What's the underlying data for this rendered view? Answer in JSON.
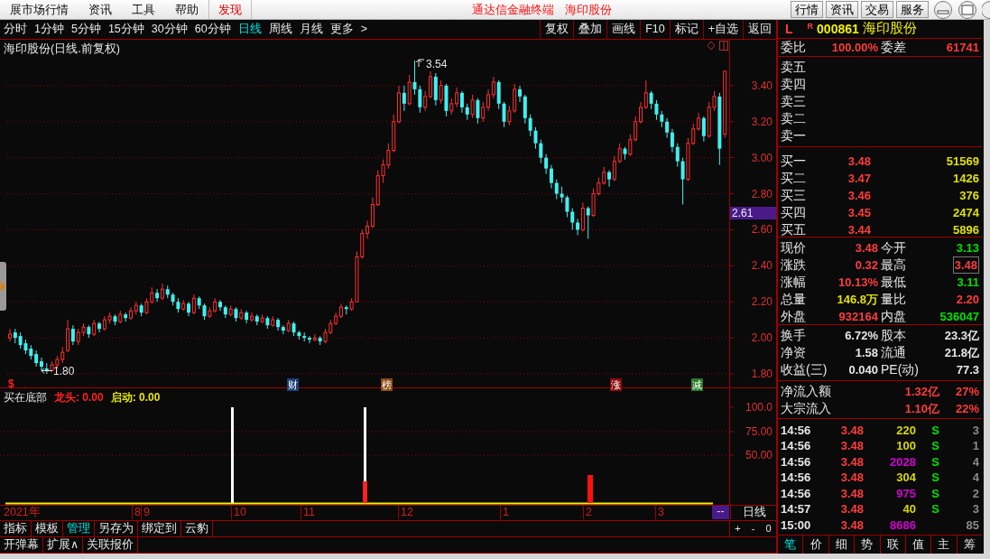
{
  "menu": [
    {
      "label": "展市场行情",
      "highlighted": false
    },
    {
      "label": "资讯",
      "highlighted": false
    },
    {
      "label": "工具",
      "highlighted": false
    },
    {
      "label": "帮助",
      "highlighted": false
    },
    {
      "label": "发现",
      "highlighted": true
    }
  ],
  "title_bar": {
    "app": "通达信金融终端",
    "stock": "海印股份"
  },
  "top_buttons": [
    "行情",
    "资讯",
    "交易",
    "服务"
  ],
  "periods": [
    {
      "label": "分时",
      "selected": false
    },
    {
      "label": "1分钟",
      "selected": false
    },
    {
      "label": "5分钟",
      "selected": false
    },
    {
      "label": "15分钟",
      "selected": false
    },
    {
      "label": "30分钟",
      "selected": false
    },
    {
      "label": "60分钟",
      "selected": false
    },
    {
      "label": "日线",
      "selected": true
    },
    {
      "label": "周线",
      "selected": false
    },
    {
      "label": "月线",
      "selected": false
    },
    {
      "label": "更多",
      "selected": false
    },
    {
      "label": ">",
      "selected": false
    }
  ],
  "chart_buttons": [
    "复权",
    "叠加",
    "画线",
    "F10",
    "标记",
    "+自选",
    "返回"
  ],
  "chart": {
    "title": "海印股份(日线.前复权)",
    "high_label": "3.54",
    "low_label": "1.80",
    "cursor_price": "2.61",
    "marker": "$",
    "badges": [
      {
        "label": "财",
        "color": "#1c3f78"
      },
      {
        "label": "榜",
        "color": "#8a4a12"
      },
      {
        "label": "涨",
        "color": "#8b0a0a"
      },
      {
        "label": "减",
        "color": "#2a7a2a"
      }
    ],
    "chart_data": {
      "type": "candlestick",
      "ylim": [
        1.79,
        3.655
      ],
      "grid": true,
      "yticks": [
        {
          "value": 3.4,
          "label": "3.40"
        },
        {
          "value": 3.2,
          "label": "3.20"
        },
        {
          "value": 3.0,
          "label": "3.00"
        },
        {
          "value": 2.8,
          "label": "2.80"
        },
        {
          "value": 2.6,
          "label": "2.60"
        },
        {
          "value": 2.4,
          "label": "2.40"
        },
        {
          "value": 2.2,
          "label": "2.20"
        },
        {
          "value": 2.0,
          "label": "2.00"
        },
        {
          "value": 1.8,
          "label": "1.80"
        }
      ],
      "ohlc": [
        [
          2.0,
          2.05,
          1.98,
          2.02
        ],
        [
          2.03,
          2.05,
          1.97,
          2.0
        ],
        [
          2.01,
          2.03,
          1.94,
          1.96
        ],
        [
          1.97,
          1.99,
          1.91,
          1.93
        ],
        [
          1.94,
          1.96,
          1.88,
          1.9
        ],
        [
          1.91,
          1.93,
          1.84,
          1.86
        ],
        [
          1.87,
          1.89,
          1.82,
          1.84
        ],
        [
          1.83,
          1.86,
          1.8,
          1.82
        ],
        [
          1.82,
          1.87,
          1.81,
          1.85
        ],
        [
          1.85,
          1.9,
          1.83,
          1.88
        ],
        [
          1.88,
          1.95,
          1.86,
          1.92
        ],
        [
          1.93,
          2.1,
          1.92,
          2.05
        ],
        [
          2.05,
          2.07,
          1.96,
          1.98
        ],
        [
          1.98,
          2.05,
          1.96,
          2.03
        ],
        [
          2.03,
          2.08,
          2.01,
          2.06
        ],
        [
          2.06,
          2.07,
          2.0,
          2.02
        ],
        [
          2.02,
          2.1,
          2.01,
          2.08
        ],
        [
          2.08,
          2.09,
          2.03,
          2.05
        ],
        [
          2.05,
          2.12,
          2.04,
          2.1
        ],
        [
          2.1,
          2.14,
          2.08,
          2.12
        ],
        [
          2.12,
          2.13,
          2.07,
          2.09
        ],
        [
          2.09,
          2.15,
          2.08,
          2.13
        ],
        [
          2.13,
          2.14,
          2.09,
          2.11
        ],
        [
          2.11,
          2.17,
          2.1,
          2.15
        ],
        [
          2.15,
          2.2,
          2.13,
          2.18
        ],
        [
          2.18,
          2.19,
          2.12,
          2.14
        ],
        [
          2.14,
          2.22,
          2.13,
          2.2
        ],
        [
          2.2,
          2.28,
          2.19,
          2.25
        ],
        [
          2.25,
          2.27,
          2.2,
          2.22
        ],
        [
          2.22,
          2.3,
          2.21,
          2.27
        ],
        [
          2.27,
          2.29,
          2.22,
          2.24
        ],
        [
          2.24,
          2.25,
          2.18,
          2.2
        ],
        [
          2.2,
          2.22,
          2.14,
          2.16
        ],
        [
          2.16,
          2.21,
          2.15,
          2.19
        ],
        [
          2.19,
          2.2,
          2.12,
          2.14
        ],
        [
          2.14,
          2.24,
          2.13,
          2.22
        ],
        [
          2.22,
          2.23,
          2.16,
          2.18
        ],
        [
          2.18,
          2.19,
          2.1,
          2.12
        ],
        [
          2.12,
          2.17,
          2.11,
          2.15
        ],
        [
          2.15,
          2.22,
          2.14,
          2.2
        ],
        [
          2.2,
          2.21,
          2.15,
          2.17
        ],
        [
          2.17,
          2.18,
          2.11,
          2.13
        ],
        [
          2.13,
          2.18,
          2.12,
          2.16
        ],
        [
          2.16,
          2.17,
          2.09,
          2.11
        ],
        [
          2.11,
          2.16,
          2.1,
          2.14
        ],
        [
          2.14,
          2.15,
          2.08,
          2.1
        ],
        [
          2.1,
          2.14,
          2.09,
          2.12
        ],
        [
          2.12,
          2.13,
          2.07,
          2.09
        ],
        [
          2.09,
          2.13,
          2.08,
          2.11
        ],
        [
          2.11,
          2.12,
          2.05,
          2.07
        ],
        [
          2.07,
          2.12,
          2.06,
          2.1
        ],
        [
          2.1,
          2.11,
          2.04,
          2.06
        ],
        [
          2.06,
          2.07,
          2.02,
          2.04
        ],
        [
          2.04,
          2.1,
          2.03,
          2.08
        ],
        [
          2.08,
          2.09,
          2.01,
          2.03
        ],
        [
          2.03,
          2.04,
          1.99,
          2.01
        ],
        [
          2.01,
          2.03,
          1.98,
          2.0
        ],
        [
          2.0,
          2.01,
          1.97,
          1.99
        ],
        [
          1.99,
          2.02,
          1.98,
          2.0
        ],
        [
          2.0,
          2.01,
          1.96,
          1.98
        ],
        [
          1.98,
          2.05,
          1.97,
          2.03
        ],
        [
          2.03,
          2.1,
          2.02,
          2.08
        ],
        [
          2.08,
          2.14,
          2.07,
          2.12
        ],
        [
          2.12,
          2.19,
          2.11,
          2.17
        ],
        [
          2.17,
          2.18,
          2.13,
          2.16
        ],
        [
          2.16,
          2.22,
          2.15,
          2.2
        ],
        [
          2.2,
          2.48,
          2.2,
          2.45
        ],
        [
          2.45,
          2.6,
          2.44,
          2.58
        ],
        [
          2.58,
          2.65,
          2.55,
          2.62
        ],
        [
          2.62,
          2.78,
          2.61,
          2.74
        ],
        [
          2.74,
          2.93,
          2.73,
          2.9
        ],
        [
          2.9,
          2.99,
          2.86,
          2.96
        ],
        [
          2.96,
          3.08,
          2.94,
          3.04
        ],
        [
          3.04,
          3.24,
          3.03,
          3.2
        ],
        [
          3.2,
          3.4,
          3.19,
          3.36
        ],
        [
          3.36,
          3.4,
          3.26,
          3.3
        ],
        [
          3.3,
          3.46,
          3.29,
          3.42
        ],
        [
          3.42,
          3.54,
          3.35,
          3.38
        ],
        [
          3.38,
          3.4,
          3.25,
          3.28
        ],
        [
          3.28,
          3.37,
          3.26,
          3.34
        ],
        [
          3.34,
          3.48,
          3.33,
          3.45
        ],
        [
          3.45,
          3.47,
          3.29,
          3.32
        ],
        [
          3.32,
          3.43,
          3.3,
          3.4
        ],
        [
          3.4,
          3.41,
          3.23,
          3.26
        ],
        [
          3.26,
          3.33,
          3.24,
          3.3
        ],
        [
          3.3,
          3.39,
          3.28,
          3.36
        ],
        [
          3.36,
          3.37,
          3.25,
          3.28
        ],
        [
          3.28,
          3.3,
          3.21,
          3.24
        ],
        [
          3.24,
          3.35,
          3.22,
          3.32
        ],
        [
          3.32,
          3.33,
          3.19,
          3.22
        ],
        [
          3.22,
          3.31,
          3.2,
          3.28
        ],
        [
          3.28,
          3.38,
          3.26,
          3.35
        ],
        [
          3.35,
          3.45,
          3.33,
          3.42
        ],
        [
          3.42,
          3.43,
          3.27,
          3.3
        ],
        [
          3.3,
          3.31,
          3.17,
          3.2
        ],
        [
          3.2,
          3.29,
          3.18,
          3.26
        ],
        [
          3.26,
          3.41,
          3.25,
          3.38
        ],
        [
          3.38,
          3.4,
          3.31,
          3.34
        ],
        [
          3.34,
          3.35,
          3.19,
          3.22
        ],
        [
          3.22,
          3.24,
          3.12,
          3.15
        ],
        [
          3.15,
          3.17,
          3.05,
          3.08
        ],
        [
          3.08,
          3.1,
          2.97,
          3.0
        ],
        [
          3.0,
          3.02,
          2.91,
          2.94
        ],
        [
          2.94,
          2.96,
          2.83,
          2.86
        ],
        [
          2.86,
          2.88,
          2.77,
          2.8
        ],
        [
          2.8,
          2.84,
          2.75,
          2.78
        ],
        [
          2.78,
          2.79,
          2.67,
          2.7
        ],
        [
          2.7,
          2.72,
          2.6,
          2.64
        ],
        [
          2.64,
          2.66,
          2.57,
          2.6
        ],
        [
          2.6,
          2.75,
          2.59,
          2.72
        ],
        [
          2.72,
          2.73,
          2.55,
          2.68
        ],
        [
          2.68,
          2.83,
          2.67,
          2.8
        ],
        [
          2.8,
          2.89,
          2.79,
          2.86
        ],
        [
          2.86,
          2.95,
          2.85,
          2.92
        ],
        [
          2.92,
          2.93,
          2.84,
          2.88
        ],
        [
          2.88,
          3.01,
          2.87,
          2.98
        ],
        [
          2.98,
          3.08,
          2.97,
          3.05
        ],
        [
          3.05,
          3.06,
          2.99,
          3.02
        ],
        [
          3.02,
          3.13,
          3.01,
          3.1
        ],
        [
          3.1,
          3.23,
          3.09,
          3.2
        ],
        [
          3.2,
          3.31,
          3.19,
          3.28
        ],
        [
          3.28,
          3.43,
          3.27,
          3.36
        ],
        [
          3.36,
          3.37,
          3.27,
          3.3
        ],
        [
          3.3,
          3.32,
          3.21,
          3.24
        ],
        [
          3.24,
          3.26,
          3.17,
          3.2
        ],
        [
          3.2,
          3.22,
          3.11,
          3.14
        ],
        [
          3.14,
          3.16,
          3.03,
          3.06
        ],
        [
          3.06,
          3.08,
          2.95,
          2.98
        ],
        [
          2.98,
          3.0,
          2.74,
          2.88
        ],
        [
          2.88,
          3.11,
          2.87,
          3.08
        ],
        [
          3.08,
          3.19,
          3.07,
          3.16
        ],
        [
          3.16,
          3.25,
          3.15,
          3.22
        ],
        [
          3.22,
          3.23,
          3.09,
          3.12
        ],
        [
          3.12,
          3.31,
          3.11,
          3.28
        ],
        [
          3.28,
          3.37,
          3.26,
          3.34
        ],
        [
          3.34,
          3.36,
          2.96,
          3.05
        ],
        [
          3.13,
          3.48,
          3.11,
          3.48
        ]
      ]
    }
  },
  "indicator": {
    "name": "买在底部",
    "lines": [
      {
        "label": "龙头: 0.00",
        "color": "#ff2020"
      },
      {
        "label": "启动: 0.00",
        "color": "#e6e600"
      }
    ],
    "axis": [
      "100.0",
      "75.00",
      "50.00"
    ]
  },
  "date_axis": [
    "2021年",
    "8",
    "9",
    "10",
    "11",
    "12",
    "1",
    "2",
    "3"
  ],
  "date_cursor": "--",
  "period_label": "日线",
  "indicator_tabs": [
    {
      "label": "指标",
      "selected": false
    },
    {
      "label": "模板",
      "selected": false
    },
    {
      "label": "管理",
      "selected": true
    },
    {
      "label": "另存为",
      "selected": false
    },
    {
      "label": "绑定到",
      "selected": false
    },
    {
      "label": "云豹",
      "selected": false
    }
  ],
  "zoom_buttons": [
    "+",
    "-",
    "0"
  ],
  "bottom_buttons": [
    "开弹幕",
    "扩展∧",
    "关联报价"
  ],
  "quote": {
    "market": "L",
    "flag": "R",
    "code": "000861",
    "name": "海印股份",
    "ratio": [
      {
        "label": "委比",
        "value": "100.00%",
        "color": "#ff3c3c"
      },
      {
        "label": "委差",
        "value": "61741",
        "color": "#ff3c3c"
      }
    ],
    "asks": [
      "卖五",
      "卖四",
      "卖三",
      "卖二",
      "卖一"
    ],
    "bids": [
      {
        "label": "买一",
        "price": "3.48",
        "volume": "51569"
      },
      {
        "label": "买二",
        "price": "3.47",
        "volume": "1426"
      },
      {
        "label": "买三",
        "price": "3.46",
        "volume": "376"
      },
      {
        "label": "买四",
        "price": "3.45",
        "volume": "2474"
      },
      {
        "label": "买五",
        "price": "3.44",
        "volume": "5896"
      }
    ],
    "stats": [
      {
        "label": "现价",
        "value": "3.48",
        "color": "#ff3c3c",
        "boxed": false
      },
      {
        "label": "今开",
        "value": "3.13",
        "color": "#00e000",
        "boxed": false
      },
      {
        "label": "涨跌",
        "value": "0.32",
        "color": "#ff3c3c",
        "boxed": false
      },
      {
        "label": "最高",
        "value": "3.48",
        "color": "#ff3c3c",
        "boxed": true
      },
      {
        "label": "涨幅",
        "value": "10.13%",
        "color": "#ff3c3c",
        "boxed": false
      },
      {
        "label": "最低",
        "value": "3.11",
        "color": "#00e000",
        "boxed": false
      },
      {
        "label": "总量",
        "value": "146.8万",
        "color": "#e0e000",
        "boxed": false
      },
      {
        "label": "量比",
        "value": "2.20",
        "color": "#ff3c3c",
        "boxed": false
      },
      {
        "label": "外盘",
        "value": "932164",
        "color": "#ff3c3c",
        "boxed": false
      },
      {
        "label": "内盘",
        "value": "536047",
        "color": "#00e000",
        "boxed": false
      }
    ],
    "finance": [
      {
        "label": "换手",
        "value": "6.72%"
      },
      {
        "label": "股本",
        "value": "23.3亿"
      },
      {
        "label": "净资",
        "value": "1.58"
      },
      {
        "label": "流通",
        "value": "21.8亿"
      },
      {
        "label": "收益(三)",
        "value": "0.040"
      },
      {
        "label": "PE(动)",
        "value": "77.3"
      }
    ],
    "flows": [
      {
        "label": "净流入额",
        "value": "1.32亿",
        "percent": "27%"
      },
      {
        "label": "大宗流入",
        "value": "1.10亿",
        "percent": "22%"
      }
    ],
    "ticks": [
      {
        "time": "14:56",
        "price": "3.48",
        "volume": "220",
        "color": "#d8d800",
        "side": "S",
        "count": "3"
      },
      {
        "time": "14:56",
        "price": "3.48",
        "volume": "100",
        "color": "#d8d800",
        "side": "S",
        "count": "1"
      },
      {
        "time": "14:56",
        "price": "3.48",
        "volume": "2028",
        "color": "#d200d2",
        "side": "S",
        "count": "4"
      },
      {
        "time": "14:56",
        "price": "3.48",
        "volume": "304",
        "color": "#d8d800",
        "side": "S",
        "count": "4"
      },
      {
        "time": "14:56",
        "price": "3.48",
        "volume": "975",
        "color": "#d200d2",
        "side": "S",
        "count": "2"
      },
      {
        "time": "14:57",
        "price": "3.48",
        "volume": "40",
        "color": "#d8d800",
        "side": "S",
        "count": "3"
      },
      {
        "time": "15:00",
        "price": "3.48",
        "volume": "8686",
        "color": "#d200d2",
        "count": "85"
      }
    ],
    "tabs": [
      {
        "label": "笔",
        "selected": true
      },
      {
        "label": "价",
        "selected": false
      },
      {
        "label": "细",
        "selected": false
      },
      {
        "label": "势",
        "selected": false
      },
      {
        "label": "联",
        "selected": false
      },
      {
        "label": "值",
        "selected": false
      },
      {
        "label": "主",
        "selected": false
      },
      {
        "label": "筹",
        "selected": false
      }
    ]
  }
}
